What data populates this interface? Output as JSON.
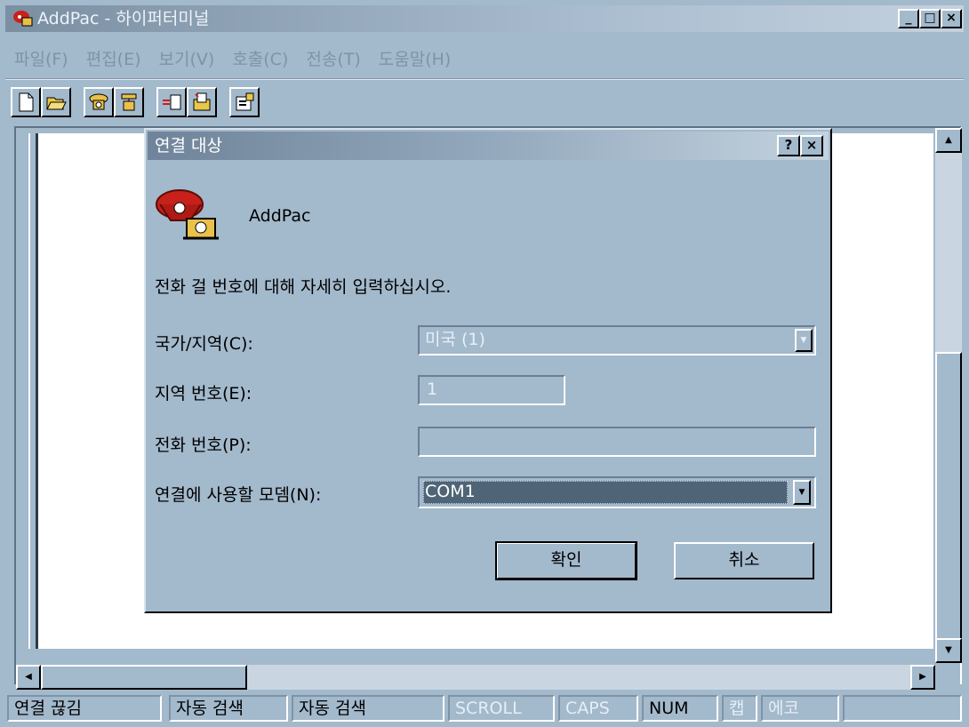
{
  "window": {
    "title": "AddPac - 하이퍼터미널",
    "minimize_label": "_",
    "maximize_label": "□",
    "close_label": "×"
  },
  "menu": [
    {
      "label": "파일(F)"
    },
    {
      "label": "편집(E)"
    },
    {
      "label": "보기(V)"
    },
    {
      "label": "호출(C)"
    },
    {
      "label": "전송(T)"
    },
    {
      "label": "도움말(H)"
    }
  ],
  "toolbar": {
    "buttons": [
      "new-icon",
      "open-icon",
      "connect-icon",
      "disconnect-icon",
      "send-icon",
      "receive-icon",
      "properties-icon"
    ]
  },
  "dialog": {
    "title": "연결 대상",
    "help_label": "?",
    "close_label": "×",
    "connection_name": "AddPac",
    "instruction": "전화 걸 번호에 대해 자세히 입력하십시오.",
    "country_label": "국가/지역(C):",
    "country_value": "미국 (1)",
    "area_label": "지역 번호(E):",
    "area_value": "1",
    "phone_label": "전화 번호(P):",
    "phone_value": "",
    "modem_label": "연결에 사용할 모뎀(N):",
    "modem_value": "COM1",
    "ok_label": "확인",
    "cancel_label": "취소"
  },
  "statusbar": {
    "connection": "연결 끊김",
    "detect1": "자동 검색",
    "detect2": "자동 검색",
    "scroll": "SCROLL",
    "caps": "CAPS",
    "num": "NUM",
    "capture": "캡",
    "echo": "에코"
  },
  "colors": {
    "face": "#a3b9cc",
    "selection": "#4f6476",
    "terminal_bg": "#ffffff"
  }
}
